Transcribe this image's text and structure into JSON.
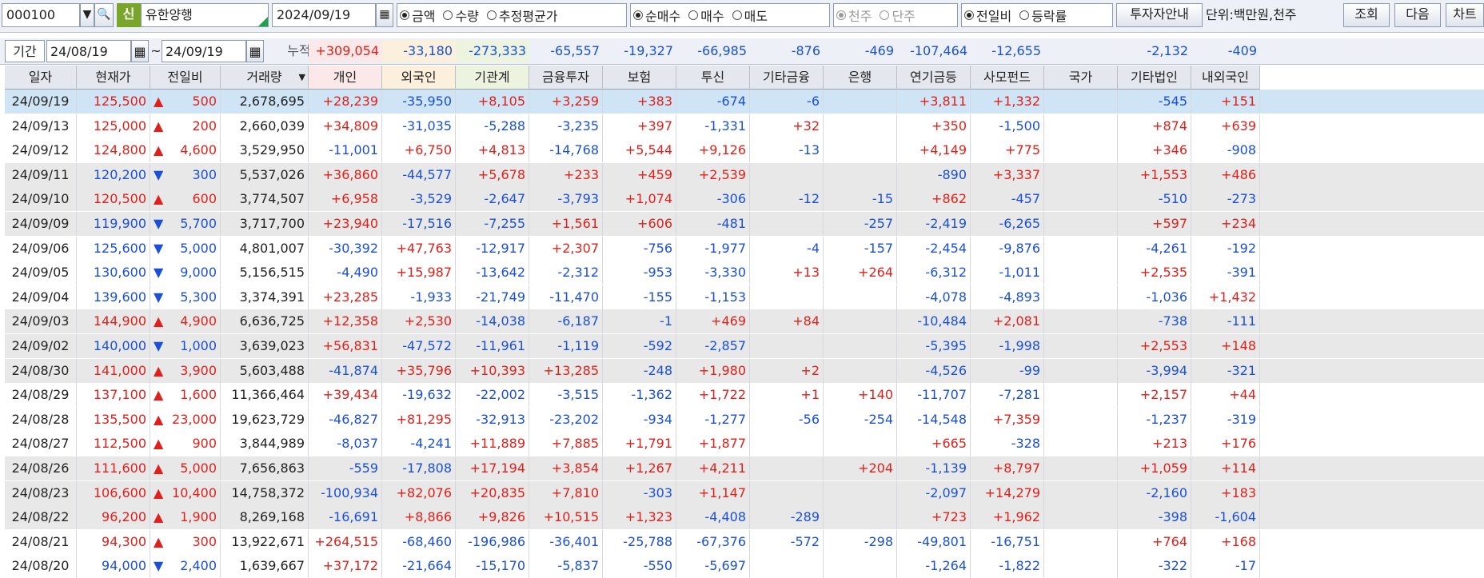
{
  "toolbar": {
    "code": "000100",
    "badge": "신",
    "name": "유한양행",
    "date": "2024/09/19",
    "measure": [
      {
        "label": "금액",
        "on": true
      },
      {
        "label": "수량",
        "on": false
      },
      {
        "label": "추정평균가",
        "on": false
      }
    ],
    "trade": [
      {
        "label": "순매수",
        "on": true
      },
      {
        "label": "매수",
        "on": false
      },
      {
        "label": "매도",
        "on": false
      }
    ],
    "unitsel": [
      {
        "label": "천주",
        "on": true
      },
      {
        "label": "단주",
        "on": false
      }
    ],
    "compare": [
      {
        "label": "전일비",
        "on": true
      },
      {
        "label": "등락률",
        "on": false
      }
    ],
    "guide_btn": "투자자안내",
    "unit_label": "단위:백만원,천주",
    "query_btn": "조회",
    "next_btn": "다음",
    "chart_btn": "차트"
  },
  "period": {
    "label": "기간",
    "from": "24/08/19",
    "tilde": "~",
    "to": "24/09/19",
    "cum_label": "누적순매수",
    "cum": [
      "+309,054",
      "-33,180",
      "-273,333",
      "-65,557",
      "-19,327",
      "-66,985",
      "-876",
      "-469",
      "-107,464",
      "-12,655",
      "",
      "-2,132",
      "-409"
    ]
  },
  "colors": {
    "up": "#e0201a",
    "down": "#1a4fd8",
    "sel_row": "#cfe4f4",
    "grey_row": "#e8e8e8",
    "ind_bg": "#fbe8e8",
    "for_bg": "#fbf0dc",
    "inst_bg": "#ecf3df"
  },
  "headers": [
    "일자",
    "현재가",
    "전일비",
    "거래량",
    "개인",
    "외국인",
    "기관계",
    "금융투자",
    "보험",
    "투신",
    "기타금융",
    "은행",
    "연기금등",
    "사모펀드",
    "국가",
    "기타법인",
    "내외국인"
  ],
  "rows": [
    [
      "24/09/19",
      "125,500",
      "up",
      "500",
      "2,678,695",
      "+28,239",
      "-35,950",
      "+8,105",
      "+3,259",
      "+383",
      "-674",
      "-6",
      "",
      "+3,811",
      "+1,332",
      "",
      "-545",
      "+151"
    ],
    [
      "24/09/13",
      "125,000",
      "up",
      "200",
      "2,660,039",
      "+34,809",
      "-31,035",
      "-5,288",
      "-3,235",
      "+397",
      "-1,331",
      "+32",
      "",
      "+350",
      "-1,500",
      "",
      "+874",
      "+639"
    ],
    [
      "24/09/12",
      "124,800",
      "up",
      "4,600",
      "3,529,950",
      "-11,001",
      "+6,750",
      "+4,813",
      "-14,768",
      "+5,544",
      "+9,126",
      "-13",
      "",
      "+4,149",
      "+775",
      "",
      "+346",
      "-908"
    ],
    [
      "24/09/11",
      "120,200",
      "down",
      "300",
      "5,537,026",
      "+36,860",
      "-44,577",
      "+5,678",
      "+233",
      "+459",
      "+2,539",
      "",
      "",
      "-890",
      "+3,337",
      "",
      "+1,553",
      "+486"
    ],
    [
      "24/09/10",
      "120,500",
      "up",
      "600",
      "3,774,507",
      "+6,958",
      "-3,529",
      "-2,647",
      "-3,793",
      "+1,074",
      "-306",
      "-12",
      "-15",
      "+862",
      "-457",
      "",
      "-510",
      "-273"
    ],
    [
      "24/09/09",
      "119,900",
      "down",
      "5,700",
      "3,717,700",
      "+23,940",
      "-17,516",
      "-7,255",
      "+1,561",
      "+606",
      "-481",
      "",
      "-257",
      "-2,419",
      "-6,265",
      "",
      "+597",
      "+234"
    ],
    [
      "24/09/06",
      "125,600",
      "down",
      "5,000",
      "4,801,007",
      "-30,392",
      "+47,763",
      "-12,917",
      "+2,307",
      "-756",
      "-1,977",
      "-4",
      "-157",
      "-2,454",
      "-9,876",
      "",
      "-4,261",
      "-192"
    ],
    [
      "24/09/05",
      "130,600",
      "down",
      "9,000",
      "5,156,515",
      "-4,490",
      "+15,987",
      "-13,642",
      "-2,312",
      "-953",
      "-3,330",
      "+13",
      "+264",
      "-6,312",
      "-1,011",
      "",
      "+2,535",
      "-391"
    ],
    [
      "24/09/04",
      "139,600",
      "down",
      "5,300",
      "3,374,391",
      "+23,285",
      "-1,933",
      "-21,749",
      "-11,470",
      "-155",
      "-1,153",
      "",
      "",
      "-4,078",
      "-4,893",
      "",
      "-1,036",
      "+1,432"
    ],
    [
      "24/09/03",
      "144,900",
      "up",
      "4,900",
      "6,636,725",
      "+12,358",
      "+2,530",
      "-14,038",
      "-6,187",
      "-1",
      "+469",
      "+84",
      "",
      "-10,484",
      "+2,081",
      "",
      "-738",
      "-111"
    ],
    [
      "24/09/02",
      "140,000",
      "down",
      "1,000",
      "3,639,023",
      "+56,831",
      "-47,572",
      "-11,961",
      "-1,119",
      "-592",
      "-2,857",
      "",
      "",
      "-5,395",
      "-1,998",
      "",
      "+2,553",
      "+148"
    ],
    [
      "24/08/30",
      "141,000",
      "up",
      "3,900",
      "5,603,488",
      "-41,874",
      "+35,796",
      "+10,393",
      "+13,285",
      "-248",
      "+1,980",
      "+2",
      "",
      "-4,526",
      "-99",
      "",
      "-3,994",
      "-321"
    ],
    [
      "24/08/29",
      "137,100",
      "up",
      "1,600",
      "11,366,464",
      "+39,434",
      "-19,632",
      "-22,002",
      "-3,515",
      "-1,362",
      "+1,722",
      "+1",
      "+140",
      "-11,707",
      "-7,281",
      "",
      "+2,157",
      "+44"
    ],
    [
      "24/08/28",
      "135,500",
      "up",
      "23,000",
      "19,623,729",
      "-46,827",
      "+81,295",
      "-32,913",
      "-23,202",
      "-934",
      "-1,277",
      "-56",
      "-254",
      "-14,548",
      "+7,359",
      "",
      "-1,237",
      "-319"
    ],
    [
      "24/08/27",
      "112,500",
      "up",
      "900",
      "3,844,989",
      "-8,037",
      "-4,241",
      "+11,889",
      "+7,885",
      "+1,791",
      "+1,877",
      "",
      "",
      "+665",
      "-328",
      "",
      "+213",
      "+176"
    ],
    [
      "24/08/26",
      "111,600",
      "up",
      "5,000",
      "7,656,863",
      "-559",
      "-17,808",
      "+17,194",
      "+3,854",
      "+1,267",
      "+4,211",
      "",
      "+204",
      "-1,139",
      "+8,797",
      "",
      "+1,059",
      "+114"
    ],
    [
      "24/08/23",
      "106,600",
      "up",
      "10,400",
      "14,758,372",
      "-100,934",
      "+82,076",
      "+20,835",
      "+7,810",
      "-303",
      "+1,147",
      "",
      "",
      "-2,097",
      "+14,279",
      "",
      "-2,160",
      "+183"
    ],
    [
      "24/08/22",
      "96,200",
      "up",
      "1,900",
      "8,269,168",
      "-16,691",
      "+8,866",
      "+9,826",
      "+10,515",
      "+1,323",
      "-4,408",
      "-289",
      "",
      "+723",
      "+1,962",
      "",
      "-398",
      "-1,604"
    ],
    [
      "24/08/21",
      "94,300",
      "up",
      "300",
      "13,922,671",
      "+264,515",
      "-68,460",
      "-196,986",
      "-36,401",
      "-25,788",
      "-67,376",
      "-572",
      "-298",
      "-49,801",
      "-16,751",
      "",
      "+764",
      "+168"
    ],
    [
      "24/08/20",
      "94,000",
      "down",
      "2,400",
      "1,639,667",
      "+37,172",
      "-21,664",
      "-15,170",
      "-5,837",
      "-550",
      "-5,697",
      "",
      "",
      "-1,264",
      "-1,822",
      "",
      "-322",
      "-17"
    ]
  ],
  "row_shade": [
    "sel",
    "w",
    "w",
    "g",
    "g",
    "g",
    "w",
    "w",
    "w",
    "g",
    "g",
    "g",
    "w",
    "w",
    "w",
    "g",
    "g",
    "g",
    "w",
    "w"
  ]
}
